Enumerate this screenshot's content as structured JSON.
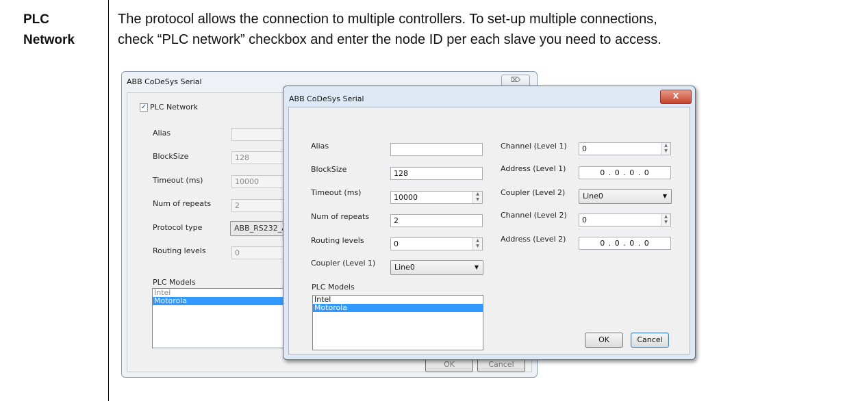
{
  "doc": {
    "side_title_line1": "PLC",
    "side_title_line2": "Network",
    "paragraph_line1": "The protocol allows the connection to multiple controllers. To set-up multiple connections,",
    "paragraph_line2": "check “PLC network” checkbox and enter the node ID per each slave you need to access."
  },
  "back_dialog": {
    "title": "ABB CoDeSys Serial",
    "close_glyph": "⌦",
    "plc_network_label": "PLC Network",
    "plc_network_checked": true,
    "alias_label": "Alias",
    "alias_value": "",
    "blocksize_label": "BlockSize",
    "blocksize_value": "128",
    "timeout_label": "Timeout (ms)",
    "timeout_value": "10000",
    "repeats_label": "Num of repeats",
    "repeats_value": "2",
    "protocol_label": "Protocol type",
    "protocol_value": "ABB_RS232_A",
    "routing_label": "Routing levels",
    "routing_value": "0",
    "models_label": "PLC Models",
    "models": [
      "Intel",
      "Motorola"
    ],
    "selected_model": "Motorola",
    "ok_label": "OK",
    "cancel_label": "Cancel"
  },
  "front_dialog": {
    "title": "ABB CoDeSys Serial",
    "close_glyph": "X",
    "alias_label": "Alias",
    "alias_value": "",
    "blocksize_label": "BlockSize",
    "blocksize_value": "128",
    "timeout_label": "Timeout (ms)",
    "timeout_value": "10000",
    "repeats_label": "Num of repeats",
    "repeats_value": "2",
    "routing_label": "Routing levels",
    "routing_value": "0",
    "coupler1_label": "Coupler (Level 1)",
    "coupler1_value": "Line0",
    "channel1_label": "Channel (Level 1)",
    "channel1_value": "0",
    "address1_label": "Address (Level 1)",
    "address1_value": "0 . 0 . 0 . 0",
    "coupler2_label": "Coupler (Level 2)",
    "coupler2_value": "Line0",
    "channel2_label": "Channel (Level 2)",
    "channel2_value": "0",
    "address2_label": "Address (Level 2)",
    "address2_value": "0 . 0 . 0 . 0",
    "models_label": "PLC Models",
    "models": [
      "Intel",
      "Motorola"
    ],
    "selected_model": "Motorola",
    "ok_label": "OK",
    "cancel_label": "Cancel"
  },
  "icons": {
    "spin_up": "▲",
    "spin_down": "▼",
    "dropdown": "▼",
    "check": "✓"
  },
  "colors": {
    "selection": "#3399ff",
    "close_button": "#c6432d"
  }
}
